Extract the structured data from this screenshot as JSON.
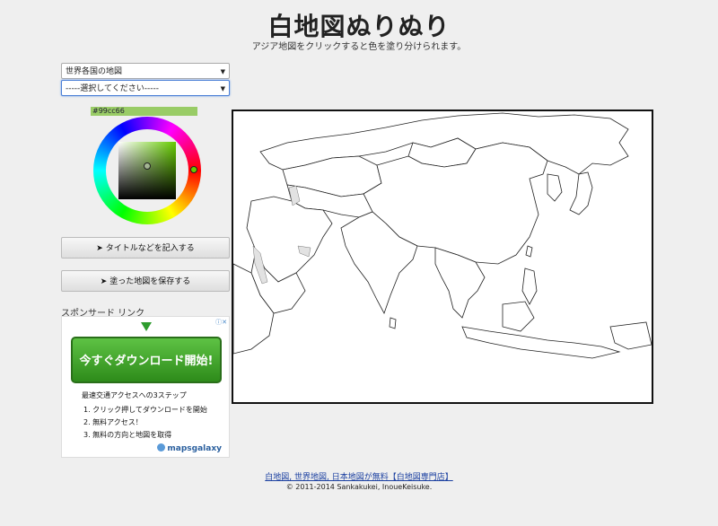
{
  "header": {
    "title": "白地図ぬりぬり",
    "subtitle": "アジア地図をクリックすると色を塗り分けられます。"
  },
  "controls": {
    "map_select_value": "世界各国の地図",
    "sub_select_value": "-----選択してください-----",
    "color_value": "#99cc66",
    "selected_color": "#99cc66",
    "button_title_label": "➤ タイトルなどを記入する",
    "button_save_label": "➤ 塗った地図を保存する"
  },
  "sponsor": {
    "label": "スポンサード リンク",
    "ad_button_label": "今すぐダウンロード開始!",
    "ad_heading": "最速交通アクセスへの3ステップ",
    "ad_steps": [
      "1. クリック押してダウンロードを開始",
      "2. 無料アクセス！",
      "3. 無料の方向と地図を取得"
    ],
    "ad_logo": "mapsgalaxy"
  },
  "map": {
    "region": "Asia"
  },
  "footer": {
    "link_text": "白地図, 世界地図, 日本地図が無料【白地図専門店】",
    "copyright": "© 2011-2014 Sankakukei, InoueKeisuke."
  }
}
